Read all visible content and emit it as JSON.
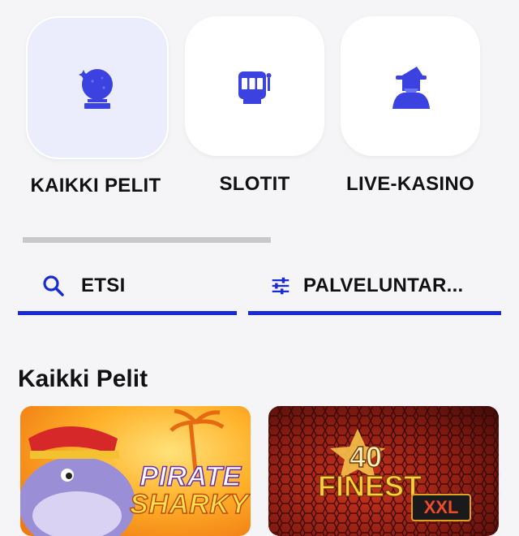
{
  "categories": [
    {
      "label": "KAIKKI PELIT",
      "icon": "crystal-ball-icon",
      "active": true
    },
    {
      "label": "SLOTIT",
      "icon": "slot-machine-icon",
      "active": false
    },
    {
      "label": "LIVE-KASINO",
      "icon": "wizard-icon",
      "active": false
    }
  ],
  "toolbar": {
    "search_label": "ETSI",
    "filter_label": "PALVELUNTAR..."
  },
  "section": {
    "title": "Kaikki Pelit"
  },
  "games": [
    {
      "title_line1": "PIRATE",
      "title_line2": "SHARKY"
    },
    {
      "title_number": "40",
      "title_word": "FINEST",
      "badge": "XXL"
    }
  ],
  "colors": {
    "accent": "#1a2bd6",
    "icon": "#3b42e0",
    "active_tile": "#ecedfc"
  }
}
